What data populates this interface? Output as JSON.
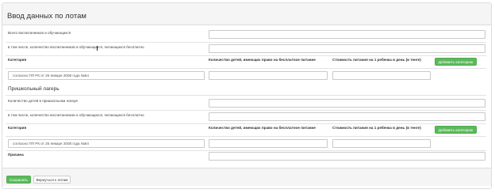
{
  "panel": {
    "title": "Ввод данных по лотам"
  },
  "main": {
    "total_students_label": "Всего воспитанников и обучающихся",
    "including_free_meals_label": "в том числе, количество воспитанников и обучающихся, питающихся бесплатно",
    "table_headers": {
      "category": "Категория",
      "children_count": "Количество детей, имеющих право на бесплатное питание",
      "meal_cost": "Стоимость питания на 1 ребенка в день (в тенге)"
    },
    "add_category_label": "Добавить категорию",
    "category_row": {
      "category_value": "согласно ПП РК от 25 январе 2008 года №64"
    }
  },
  "school_camp": {
    "section_title": "Пришкольный лагерь",
    "camp_children_label": "Количество детей в пришкольном лагере",
    "including_free_meals_label": "в том числе, количество воспитанников и обучающихся, питающихся бесплатно",
    "table_headers": {
      "category": "Категория",
      "children_count": "Количество детей, имеющих право на бесплатное питание",
      "meal_cost": "Стоимость питания на 1 ребенка в день (в тенге)"
    },
    "add_category_label": "Добавить категорию",
    "category_row": {
      "category_value": "согласно ПП РК от 25 январе 2008 года №64"
    },
    "reason_label": "Причина"
  },
  "footer": {
    "save_label": "Сохранить",
    "back_label": "Вернуться к лотам"
  },
  "colors": {
    "primary_green": "#5cb85c",
    "panel_bg": "#f5f5f5",
    "border": "#dcdcdc"
  }
}
